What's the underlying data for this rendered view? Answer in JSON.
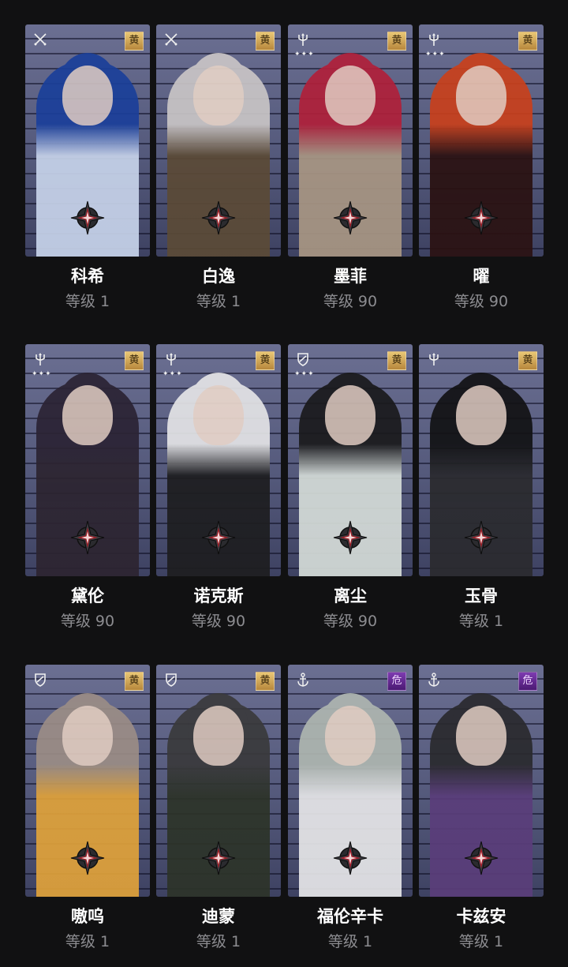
{
  "characters": [
    {
      "name": "科希",
      "level": "等级 1",
      "class_icon": "crossed-swords-icon",
      "stars": "",
      "badge": "黄",
      "badge_color": "gold",
      "hair": "#1b3f9a",
      "outfit": "#c7d3ea"
    },
    {
      "name": "白逸",
      "level": "等级 1",
      "class_icon": "crossed-swords-icon",
      "stars": "",
      "badge": "黄",
      "badge_color": "gold",
      "hair": "#c9c5c6",
      "outfit": "#5b4a36"
    },
    {
      "name": "墨菲",
      "level": "等级 90",
      "class_icon": "trident-icon",
      "stars": "✦✦✦",
      "badge": "黄",
      "badge_color": "gold",
      "hair": "#b0203a",
      "outfit": "#a89683"
    },
    {
      "name": "曜",
      "level": "等级 90",
      "class_icon": "trident-icon",
      "stars": "✦✦✦",
      "badge": "黄",
      "badge_color": "gold",
      "hair": "#c9401c",
      "outfit": "#2a1111"
    },
    {
      "name": "黛伦",
      "level": "等级 90",
      "class_icon": "trident-icon",
      "stars": "✦✦✦",
      "badge": "黄",
      "badge_color": "gold",
      "hair": "#2b2334",
      "outfit": "#2c2430"
    },
    {
      "name": "诺克斯",
      "level": "等级 90",
      "class_icon": "trident-icon",
      "stars": "✦✦✦",
      "badge": "黄",
      "badge_color": "gold",
      "hair": "#e4e4e6",
      "outfit": "#1d1d1f"
    },
    {
      "name": "离尘",
      "level": "等级 90",
      "class_icon": "shield-icon",
      "stars": "✦✦✦",
      "badge": "黄",
      "badge_color": "gold",
      "hair": "#1a1a1c",
      "outfit": "#d5dcd8"
    },
    {
      "name": "玉骨",
      "level": "等级 1",
      "class_icon": "trident-icon",
      "stars": "",
      "badge": "黄",
      "badge_color": "gold",
      "hair": "#121214",
      "outfit": "#2a2a2e"
    },
    {
      "name": "嗷呜",
      "level": "等级 1",
      "class_icon": "shield-icon",
      "stars": "",
      "badge": "黄",
      "badge_color": "gold",
      "hair": "#9b8d86",
      "outfit": "#e0a23a"
    },
    {
      "name": "迪蒙",
      "level": "等级 1",
      "class_icon": "shield-icon",
      "stars": "",
      "badge": "黄",
      "badge_color": "gold",
      "hair": "#3a3a3c",
      "outfit": "#2c3328"
    },
    {
      "name": "福伦辛卡",
      "level": "等级 1",
      "class_icon": "anchor-icon",
      "stars": "",
      "badge": "危",
      "badge_color": "purple",
      "hair": "#aeb6b0",
      "outfit": "#e6e6e8"
    },
    {
      "name": "卡兹安",
      "level": "等级 1",
      "class_icon": "anchor-icon",
      "stars": "",
      "badge": "危",
      "badge_color": "purple",
      "hair": "#2a2a2e",
      "outfit": "#5a3d7a"
    }
  ]
}
